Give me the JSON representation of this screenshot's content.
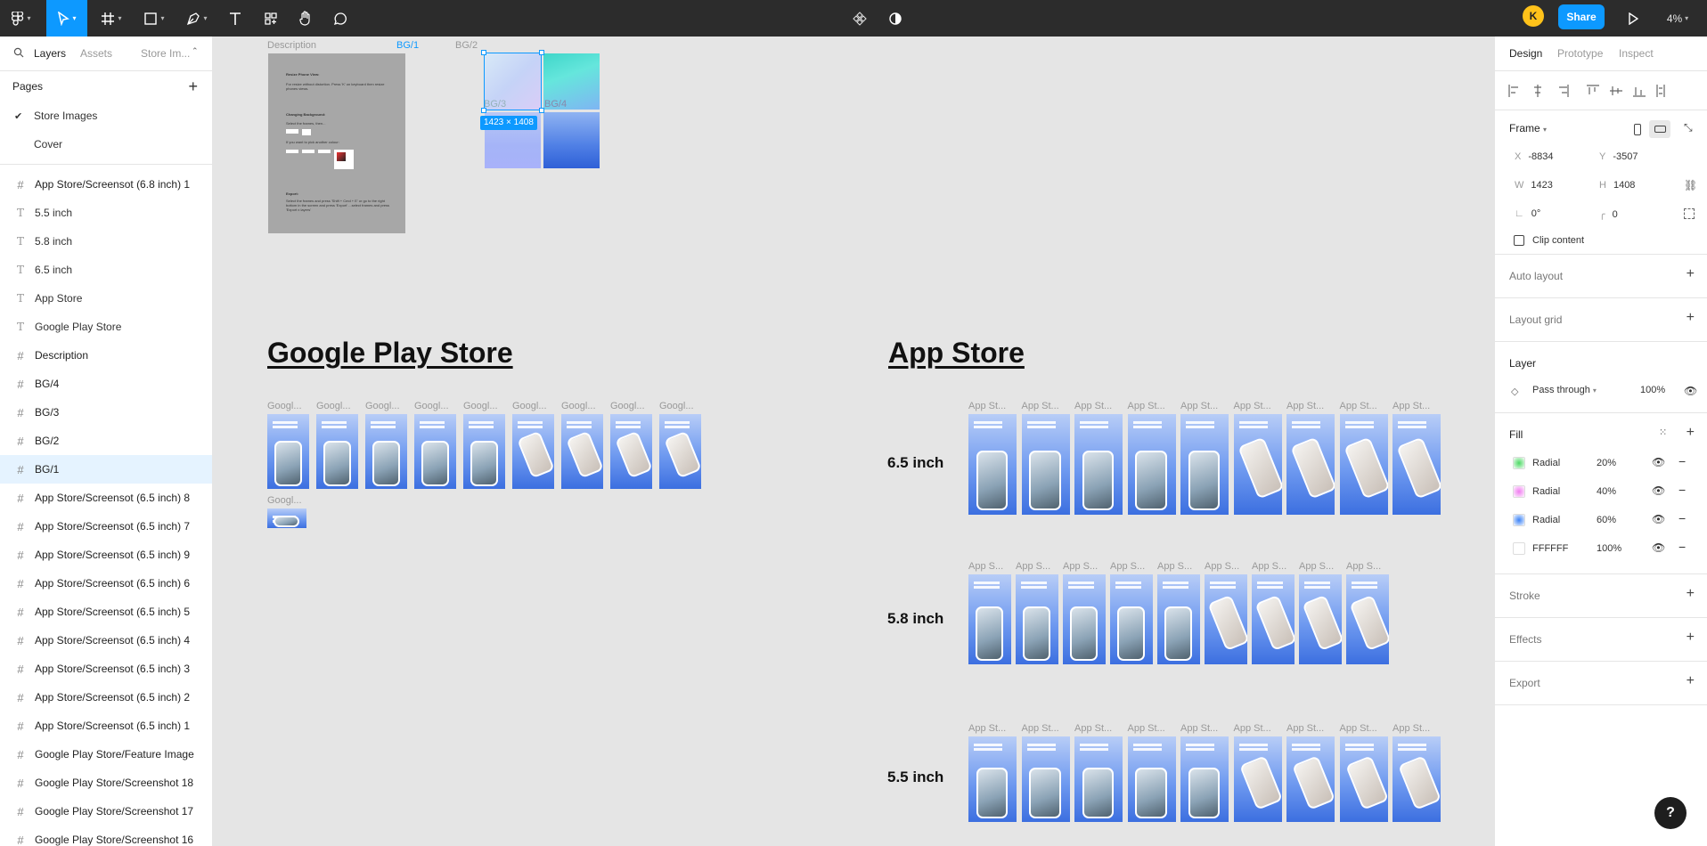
{
  "toolbar": {
    "share_label": "Share",
    "zoom": "4%",
    "avatar_initial": "K"
  },
  "left": {
    "tabs": [
      "Layers",
      "Assets",
      "Store Im..."
    ],
    "pages_title": "Pages",
    "pages": [
      "Store Images",
      "Cover"
    ],
    "layers": [
      {
        "label": "App Store/Screensot (6.8 inch) 1",
        "kind": "frame"
      },
      {
        "label": "5.5 inch",
        "kind": "text"
      },
      {
        "label": "5.8 inch",
        "kind": "text"
      },
      {
        "label": "6.5 inch",
        "kind": "text"
      },
      {
        "label": "App Store",
        "kind": "text"
      },
      {
        "label": "Google Play Store",
        "kind": "text"
      },
      {
        "label": "Description",
        "kind": "frame"
      },
      {
        "label": "BG/4",
        "kind": "frame"
      },
      {
        "label": "BG/3",
        "kind": "frame"
      },
      {
        "label": "BG/2",
        "kind": "frame"
      },
      {
        "label": "BG/1",
        "kind": "frame",
        "selected": true
      },
      {
        "label": "App Store/Screensot (6.5 inch) 8",
        "kind": "frame"
      },
      {
        "label": "App Store/Screensot (6.5 inch) 7",
        "kind": "frame"
      },
      {
        "label": "App Store/Screensot (6.5 inch) 9",
        "kind": "frame"
      },
      {
        "label": "App Store/Screensot (6.5 inch) 6",
        "kind": "frame"
      },
      {
        "label": "App Store/Screensot (6.5 inch) 5",
        "kind": "frame"
      },
      {
        "label": "App Store/Screensot (6.5 inch) 4",
        "kind": "frame"
      },
      {
        "label": "App Store/Screensot (6.5 inch) 3",
        "kind": "frame"
      },
      {
        "label": "App Store/Screensot (6.5 inch) 2",
        "kind": "frame"
      },
      {
        "label": "App Store/Screensot (6.5 inch) 1",
        "kind": "frame"
      },
      {
        "label": "Google Play Store/Feature Image",
        "kind": "frame"
      },
      {
        "label": "Google Play Store/Screenshot 18",
        "kind": "frame"
      },
      {
        "label": "Google Play Store/Screenshot 17",
        "kind": "frame"
      },
      {
        "label": "Google Play Store/Screenshot 16",
        "kind": "frame"
      }
    ]
  },
  "canvas": {
    "description_label": "Description",
    "description_text": {
      "h1": "Resize Phone View:",
      "p1": "For resize without distortion. Press 'K' on keyboard then resize phones views.",
      "h2": "Changing Background:",
      "p2": "Select the frames, then...",
      "p3": "If you want to pick another colour:",
      "h3": "Export:",
      "p4": "Select the frames and press 'Shift + Cmd + E' or go to the right bottom in the screen and press 'Export' ...select frames and press 'Export x layers'"
    },
    "bg_labels": [
      "BG/1",
      "BG/2",
      "BG/3",
      "BG/4"
    ],
    "selection_size": "1423 × 1408",
    "google_heading": "Google Play Store",
    "app_heading": "App Store",
    "google_shot_label": "Googl...",
    "app_shot_label_65": "App St...",
    "app_shot_label_58": "App S...",
    "app_shot_label_55": "App St...",
    "size_65": "6.5 inch",
    "size_58": "5.8 inch",
    "size_55": "5.5 inch"
  },
  "right": {
    "tabs": [
      "Design",
      "Prototype",
      "Inspect"
    ],
    "frame_title": "Frame",
    "x_label": "X",
    "x": "-8834",
    "y_label": "Y",
    "y": "-3507",
    "w_label": "W",
    "w": "1423",
    "h_label": "H",
    "h": "1408",
    "rotation": "0°",
    "radius": "0",
    "clip_content": "Clip content",
    "auto_layout": "Auto layout",
    "layout_grid": "Layout grid",
    "layer_title": "Layer",
    "blend": "Pass through",
    "layer_opacity": "100%",
    "fill_title": "Fill",
    "fills": [
      {
        "type": "Radial",
        "opacity": "20%",
        "color": "#4cd964"
      },
      {
        "type": "Radial",
        "opacity": "40%",
        "color": "#f07cf0"
      },
      {
        "type": "Radial",
        "opacity": "60%",
        "color": "#3b82f6"
      },
      {
        "type": "FFFFFF",
        "opacity": "100%",
        "color": "#ffffff"
      }
    ],
    "stroke": "Stroke",
    "effects": "Effects",
    "export": "Export"
  },
  "help": "?"
}
